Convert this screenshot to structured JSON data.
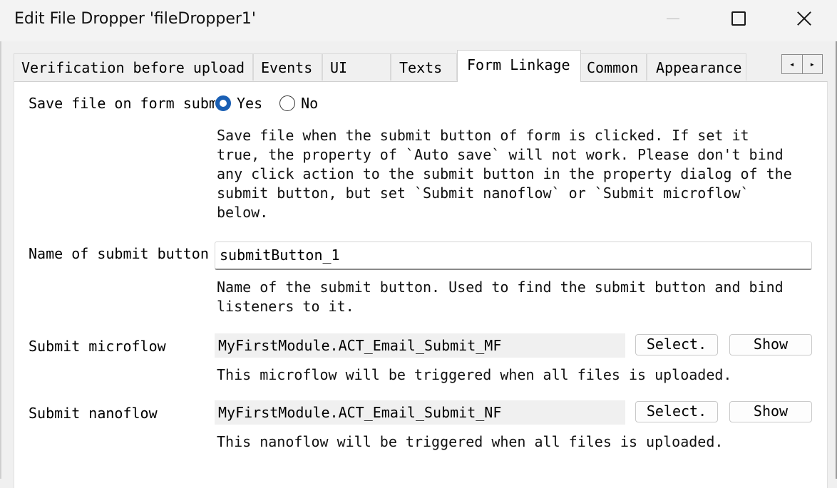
{
  "window": {
    "title": "Edit File Dropper 'fileDropper1'",
    "minimize": "minimize",
    "maximize": "maximize",
    "close": "close"
  },
  "tabs": [
    {
      "label": "Verification before upload"
    },
    {
      "label": "Events"
    },
    {
      "label": "UI"
    },
    {
      "label": "Texts"
    },
    {
      "label": "Form Linkage"
    },
    {
      "label": "Common"
    },
    {
      "label": "Appearance"
    }
  ],
  "active_tab": "Form Linkage",
  "scroll": {
    "left": "◂",
    "right": "▸"
  },
  "form": {
    "save_file": {
      "label": "Save file on form subm",
      "options": [
        {
          "label": "Yes",
          "selected": true
        },
        {
          "label": "No",
          "selected": false
        }
      ],
      "help": "Save file when the submit button of form is clicked. If set it\ntrue, the property of `Auto save` will not work. Please don't bind\nany click action to the submit button in the property dialog of the\nsubmit button, but set `Submit nanoflow` or `Submit microflow`\nbelow."
    },
    "submit_button_name": {
      "label": "Name of submit button",
      "value": "submitButton_1",
      "help": "Name of the submit button. Used to find the submit button and bind\nlisteners to it."
    },
    "submit_microflow": {
      "label": "Submit microflow",
      "value": "MyFirstModule.ACT_Email_Submit_MF",
      "select_label": "Select.",
      "show_label": "Show",
      "help": "This microflow will be triggered when all files is uploaded."
    },
    "submit_nanoflow": {
      "label": "Submit nanoflow",
      "value": "MyFirstModule.ACT_Email_Submit_NF",
      "select_label": "Select.",
      "show_label": "Show",
      "help": "This nanoflow will be triggered when all files is uploaded."
    }
  }
}
